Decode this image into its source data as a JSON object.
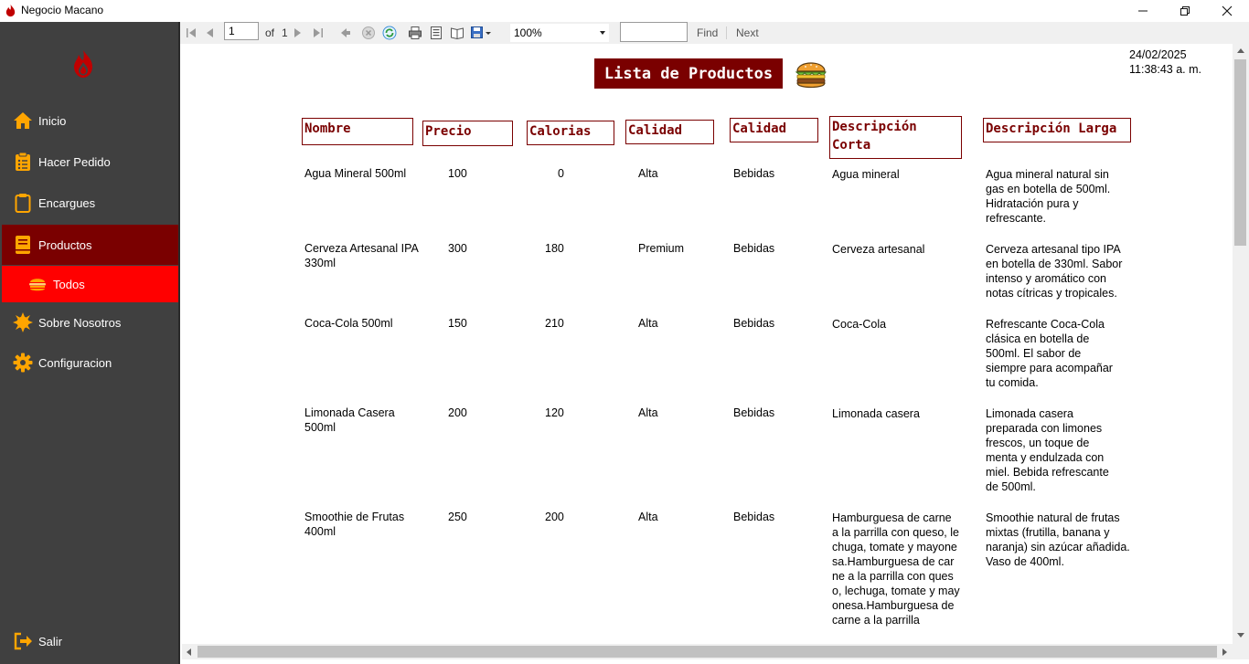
{
  "window": {
    "title": "Negocio Macano",
    "minimize_icon": "minimize-icon",
    "restore_icon": "restore-icon",
    "close_icon": "close-icon"
  },
  "sidebar": {
    "logo": "flame-logo",
    "items": [
      {
        "label": "Inicio",
        "icon": "home-icon"
      },
      {
        "label": "Hacer Pedido",
        "icon": "order-list-icon"
      },
      {
        "label": "Encargues",
        "icon": "clipboard-icon"
      },
      {
        "label": "Productos",
        "icon": "book-icon"
      },
      {
        "label": "Todos",
        "icon": "burger-icon"
      },
      {
        "label": "Sobre Nosotros",
        "icon": "sun-icon"
      },
      {
        "label": "Configuracion",
        "icon": "gear-icon"
      }
    ],
    "exit_label": "Salir",
    "colors": {
      "bg": "#404040",
      "active": "#7a0000",
      "sub_active": "#ff0000",
      "icon": "#ffa500"
    }
  },
  "toolbar": {
    "page_value": "1",
    "of_label": "of",
    "total_pages": "1",
    "zoom_value": "100%",
    "find_label": "Find",
    "next_label": "Next"
  },
  "report": {
    "title": "Lista de Productos",
    "date": "24/02/2025",
    "time": "11:38:43 a. m.",
    "headers": [
      "Nombre",
      "Precio",
      "Calorias",
      "Calidad",
      "Calidad",
      "Descripción Corta",
      "Descripción Larga"
    ],
    "rows": [
      {
        "nombre": "Agua Mineral 500ml",
        "precio": "100",
        "calorias": "0",
        "calidad": "Alta",
        "categoria": "Bebidas",
        "corta": "Agua mineral",
        "larga": "Agua mineral natural sin gas en botella de 500ml. Hidratación pura y refrescante."
      },
      {
        "nombre": "Cerveza Artesanal IPA 330ml",
        "precio": "300",
        "calorias": "180",
        "calidad": "Premium",
        "categoria": "Bebidas",
        "corta": "Cerveza artesanal",
        "larga": "Cerveza artesanal tipo IPA en botella de 330ml. Sabor intenso y aromático con notas cítricas y tropicales."
      },
      {
        "nombre": "Coca-Cola 500ml",
        "precio": "150",
        "calorias": "210",
        "calidad": "Alta",
        "categoria": "Bebidas",
        "corta": "Coca-Cola",
        "larga": "Refrescante Coca-Cola clásica en botella de 500ml. El sabor de siempre para acompañar tu comida."
      },
      {
        "nombre": "Limonada Casera 500ml",
        "precio": "200",
        "calorias": "120",
        "calidad": "Alta",
        "categoria": "Bebidas",
        "corta": "Limonada casera",
        "larga": "Limonada casera preparada con limones frescos, un toque de menta y endulzada con miel. Bebida refrescante de 500ml."
      },
      {
        "nombre": "Smoothie de Frutas 400ml",
        "precio": "250",
        "calorias": "200",
        "calidad": "Alta",
        "categoria": "Bebidas",
        "corta": "Hamburguesa de carne a la parrilla con queso, lechuga, tomate y mayonesa.Hamburguesa de carne a la parrilla con queso, lechuga, tomate y mayonesa.Hamburguesa de carne a la parrilla",
        "larga": "Smoothie natural de frutas mixtas (frutilla, banana y naranja) sin azúcar añadida. Vaso de 400ml."
      }
    ]
  }
}
